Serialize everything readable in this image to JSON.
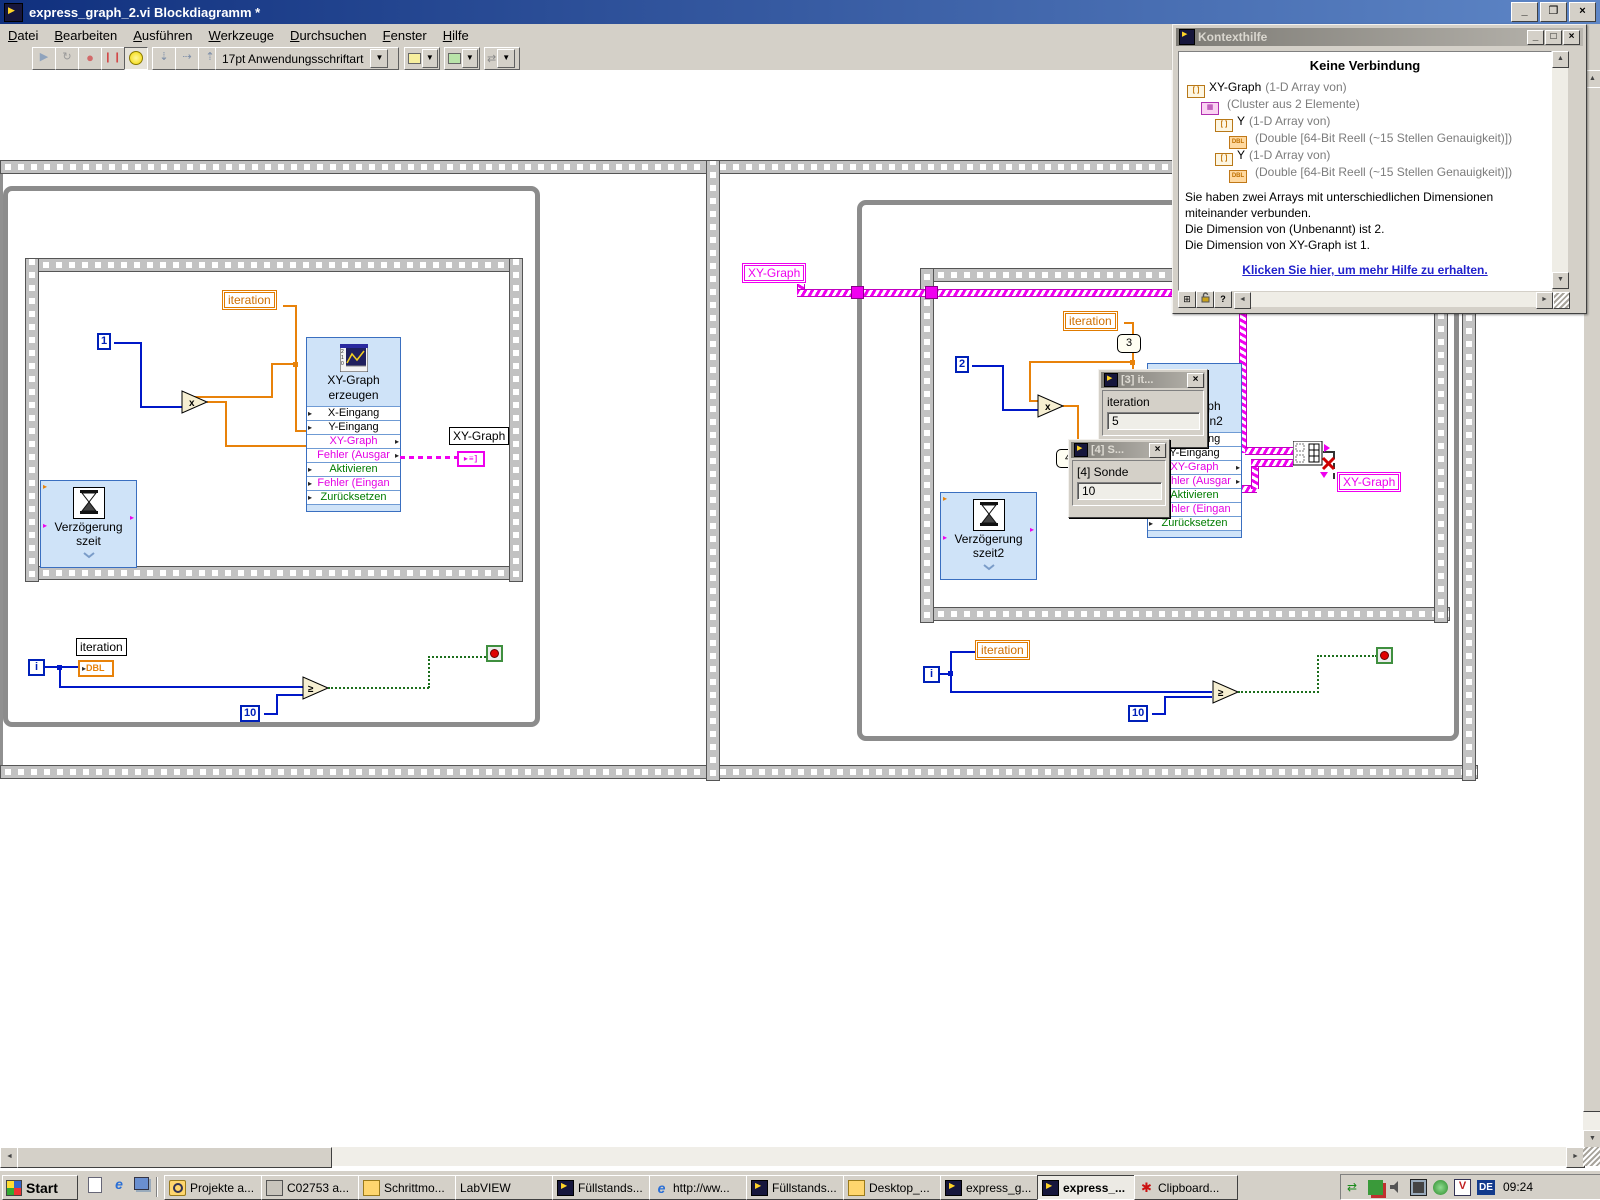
{
  "window": {
    "title": "express_graph_2.vi Blockdiagramm *"
  },
  "menu": {
    "items": [
      "Datei",
      "Bearbeiten",
      "Ausführen",
      "Werkzeuge",
      "Durchsuchen",
      "Fenster",
      "Hilfe"
    ]
  },
  "toolbar": {
    "font_selector": "17pt Anwendungsschriftart"
  },
  "context_help": {
    "title": "Kontexthilfe",
    "heading": "Keine Verbindung",
    "tree": [
      {
        "icon": "array-icon",
        "name": "XY-Graph",
        "type": "(1-D Array von)"
      },
      {
        "icon": "cluster-icon",
        "name": "",
        "type": "(Cluster aus 2 Elemente)"
      },
      {
        "icon": "array-icon",
        "name": "Y",
        "type": "(1-D Array von)"
      },
      {
        "icon": "dbl-icon",
        "name": "",
        "type": "(Double [64-Bit Reell (~15 Stellen Genauigkeit)])"
      },
      {
        "icon": "array-icon",
        "name": "Y",
        "type": "(1-D Array von)"
      },
      {
        "icon": "dbl-icon",
        "name": "",
        "type": "(Double [64-Bit Reell (~15 Stellen Genauigkeit)])"
      }
    ],
    "message_lines": [
      "Sie haben zwei Arrays mit unterschiedlichen Dimensionen",
      "miteinander verbunden.",
      "Die Dimension von (Unbenannt) ist 2.",
      "Die Dimension von XY-Graph ist 1."
    ],
    "link": "Klicken Sie hier, um mehr Hilfe zu erhalten."
  },
  "diagram": {
    "express_rows": [
      "X-Eingang",
      "Y-Eingang",
      "XY-Graph",
      "Fehler (Ausgar",
      "Aktivieren",
      "Fehler (Eingan",
      "Zurücksetzen"
    ],
    "multiply_glyph": "x",
    "gte_glyph": "≥",
    "left_loop": {
      "iteration_label": "iteration",
      "const_one": "1",
      "express_title_1": "XY-Graph",
      "express_title_2": "erzeugen",
      "indicator_label": "XY-Graph",
      "delay_line1": "Verzögerung",
      "delay_line2": "szeit",
      "i_terminal": "i",
      "iteration_indicator": "iteration",
      "dbl_terminal": "DBL",
      "limit_const": "10"
    },
    "right_loop": {
      "control_label": "XY-Graph",
      "iteration_label": "iteration",
      "probe3_badge": "3",
      "probe4_badge": "4",
      "const_two": "2",
      "express_title_1": "XY-Graph",
      "express_title_2": "erzeugen2",
      "indicator_label": "XY-Graph",
      "delay_line1": "Verzögerung",
      "delay_line2": "szeit2",
      "i_terminal": "i",
      "iteration_indicator": "iteration",
      "limit_const": "10"
    }
  },
  "probes": {
    "p3": {
      "title": "[3] it...",
      "label": "iteration",
      "value": "5"
    },
    "p4": {
      "title": "[4] S...",
      "label": "[4] Sonde",
      "value": "10"
    }
  },
  "taskbar": {
    "start": "Start",
    "tasks": [
      {
        "label": "Projekte a..."
      },
      {
        "label": "C02753 a..."
      },
      {
        "label": "Schrittmo..."
      },
      {
        "label": "LabVIEW"
      },
      {
        "label": "Füllstands..."
      },
      {
        "label": "http://ww..."
      },
      {
        "label": "Füllstands..."
      },
      {
        "label": "Desktop_..."
      },
      {
        "label": "express_g..."
      },
      {
        "label": "express_..."
      },
      {
        "label": "Clipboard..."
      }
    ],
    "tray": {
      "locale": "DE",
      "time": "09:24"
    }
  }
}
